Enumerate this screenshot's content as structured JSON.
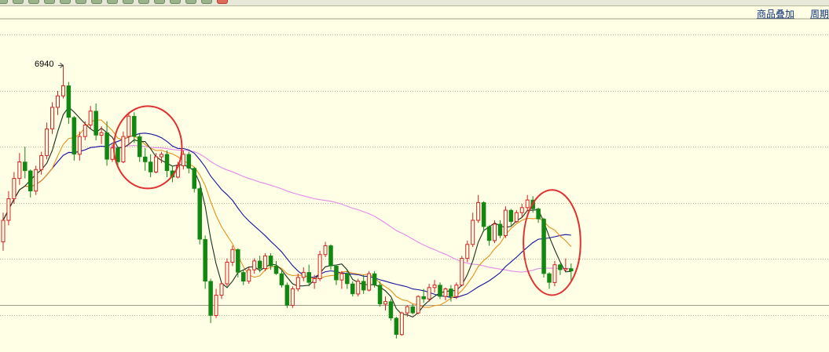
{
  "toolbar": {
    "tabs": [
      "",
      "",
      "",
      "",
      "",
      "",
      "",
      "",
      "",
      "",
      "",
      "",
      "",
      "",
      ""
    ],
    "right_links": {
      "overlay": "商品叠加",
      "period": "周期"
    }
  },
  "chart_data": {
    "type": "candlestick",
    "annotation": {
      "label": "6940",
      "value": 6940
    },
    "up_color": "#d42020",
    "down_color": "#118811",
    "ma_colors": {
      "ma5": "#1c2e1c",
      "ma10": "#e8901c",
      "ma20": "#14149a",
      "ma60": "#e48ae8"
    },
    "circle_color": "#e03030",
    "ylim": [
      4800,
      7270
    ],
    "candles": [
      [
        5550,
        5780,
        5480,
        5720
      ],
      [
        5720,
        5950,
        5680,
        5890
      ],
      [
        5890,
        6100,
        5850,
        6050
      ],
      [
        6050,
        6250,
        6000,
        6180
      ],
      [
        6180,
        6300,
        6050,
        6110
      ],
      [
        6110,
        6120,
        5900,
        5950
      ],
      [
        5950,
        6150,
        5920,
        6120
      ],
      [
        6120,
        6260,
        6080,
        6230
      ],
      [
        6230,
        6490,
        6200,
        6440
      ],
      [
        6440,
        6650,
        6400,
        6610
      ],
      [
        6610,
        6740,
        6550,
        6700
      ],
      [
        6700,
        6940,
        6680,
        6780
      ],
      [
        6780,
        6810,
        6480,
        6530
      ],
      [
        6530,
        6540,
        6190,
        6240
      ],
      [
        6240,
        6420,
        6190,
        6380
      ],
      [
        6380,
        6500,
        6350,
        6470
      ],
      [
        6470,
        6620,
        6440,
        6580
      ],
      [
        6580,
        6640,
        6350,
        6390
      ],
      [
        6390,
        6460,
        6320,
        6410
      ],
      [
        6410,
        6500,
        6150,
        6200
      ],
      [
        6200,
        6320,
        6180,
        6290
      ],
      [
        6290,
        6300,
        6140,
        6180
      ],
      [
        6180,
        6420,
        6170,
        6380
      ],
      [
        6380,
        6570,
        6320,
        6540
      ],
      [
        6540,
        6570,
        6330,
        6380
      ],
      [
        6380,
        6400,
        6180,
        6220
      ],
      [
        6220,
        6290,
        6110,
        6180
      ],
      [
        6180,
        6240,
        6060,
        6100
      ],
      [
        6100,
        6250,
        6090,
        6220
      ],
      [
        6220,
        6260,
        6170,
        6240
      ],
      [
        6240,
        6270,
        6060,
        6110
      ],
      [
        6110,
        6150,
        6020,
        6060
      ],
      [
        6060,
        6180,
        6050,
        6150
      ],
      [
        6150,
        6270,
        6120,
        6240
      ],
      [
        6240,
        6260,
        6090,
        6130
      ],
      [
        6130,
        6140,
        5940,
        5970
      ],
      [
        5970,
        5980,
        5530,
        5570
      ],
      [
        5570,
        5600,
        5180,
        5240
      ],
      [
        5240,
        5260,
        4910,
        4970
      ],
      [
        4970,
        5180,
        4950,
        5130
      ],
      [
        5130,
        5230,
        5100,
        5220
      ],
      [
        5220,
        5420,
        5200,
        5390
      ],
      [
        5390,
        5520,
        5360,
        5490
      ],
      [
        5490,
        5500,
        5270,
        5310
      ],
      [
        5310,
        5330,
        5210,
        5240
      ],
      [
        5240,
        5350,
        5220,
        5330
      ],
      [
        5330,
        5420,
        5300,
        5400
      ],
      [
        5400,
        5440,
        5310,
        5340
      ],
      [
        5340,
        5460,
        5320,
        5440
      ],
      [
        5440,
        5460,
        5330,
        5360
      ],
      [
        5360,
        5400,
        5290,
        5300
      ],
      [
        5300,
        5330,
        5190,
        5210
      ],
      [
        5210,
        5230,
        5030,
        5050
      ],
      [
        5050,
        5200,
        5030,
        5180
      ],
      [
        5180,
        5300,
        5160,
        5270
      ],
      [
        5270,
        5350,
        5240,
        5310
      ],
      [
        5310,
        5370,
        5200,
        5230
      ],
      [
        5230,
        5290,
        5180,
        5260
      ],
      [
        5260,
        5480,
        5240,
        5450
      ],
      [
        5450,
        5550,
        5430,
        5520
      ],
      [
        5520,
        5530,
        5330,
        5360
      ],
      [
        5360,
        5370,
        5210,
        5250
      ],
      [
        5250,
        5320,
        5180,
        5300
      ],
      [
        5300,
        5330,
        5180,
        5220
      ],
      [
        5220,
        5240,
        5120,
        5140
      ],
      [
        5140,
        5260,
        5120,
        5240
      ],
      [
        5240,
        5290,
        5140,
        5170
      ],
      [
        5170,
        5320,
        5160,
        5300
      ],
      [
        5300,
        5320,
        5190,
        5210
      ],
      [
        5210,
        5240,
        5040,
        5060
      ],
      [
        5060,
        5120,
        5010,
        5080
      ],
      [
        5080,
        5100,
        4930,
        4950
      ],
      [
        4950,
        4960,
        4790,
        4820
      ],
      [
        4820,
        5000,
        4810,
        4990
      ],
      [
        4990,
        5050,
        4960,
        5040
      ],
      [
        5040,
        5060,
        4980,
        4990
      ],
      [
        4990,
        5130,
        4980,
        5120
      ],
      [
        5120,
        5180,
        5070,
        5100
      ],
      [
        5100,
        5220,
        5080,
        5190
      ],
      [
        5190,
        5250,
        5150,
        5210
      ],
      [
        5210,
        5230,
        5100,
        5120
      ],
      [
        5120,
        5190,
        5090,
        5180
      ],
      [
        5180,
        5210,
        5080,
        5120
      ],
      [
        5120,
        5230,
        5100,
        5210
      ],
      [
        5210,
        5440,
        5200,
        5420
      ],
      [
        5420,
        5560,
        5390,
        5530
      ],
      [
        5530,
        5780,
        5510,
        5720
      ],
      [
        5720,
        5920,
        5700,
        5860
      ],
      [
        5860,
        5870,
        5630,
        5670
      ],
      [
        5670,
        5680,
        5520,
        5560
      ],
      [
        5560,
        5720,
        5540,
        5690
      ],
      [
        5690,
        5720,
        5580,
        5600
      ],
      [
        5600,
        5830,
        5580,
        5800
      ],
      [
        5800,
        5810,
        5680,
        5710
      ],
      [
        5710,
        5800,
        5700,
        5780
      ],
      [
        5780,
        5850,
        5740,
        5820
      ],
      [
        5820,
        5920,
        5790,
        5880
      ],
      [
        5880,
        5910,
        5780,
        5810
      ],
      [
        5810,
        5820,
        5700,
        5730
      ],
      [
        5730,
        5740,
        5270,
        5300
      ],
      [
        5300,
        5310,
        5180,
        5230
      ],
      [
        5230,
        5400,
        5200,
        5370
      ],
      [
        5370,
        5380,
        5290,
        5330
      ],
      [
        5330,
        5420,
        5320,
        5340
      ],
      [
        5340,
        5380,
        5240,
        5320
      ]
    ],
    "circles": [
      {
        "label": "",
        "start": 22,
        "end": 31
      },
      {
        "label": "",
        "start": 97,
        "end": 105
      }
    ]
  }
}
